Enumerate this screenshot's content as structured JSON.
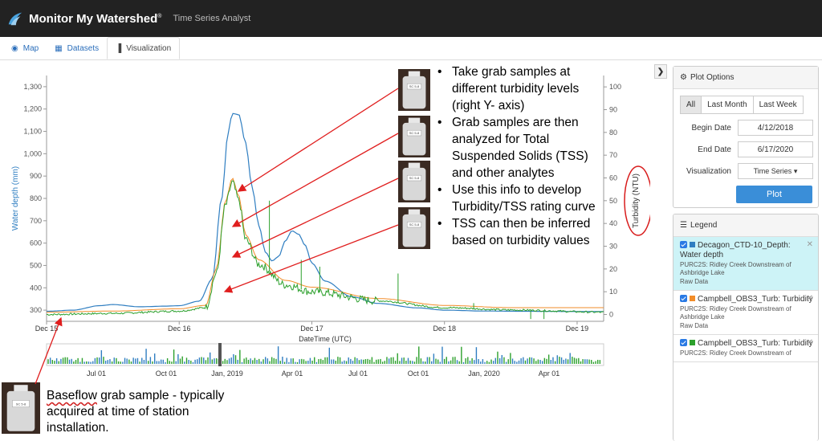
{
  "app": {
    "brand": "Monitor My Watershed",
    "trademark": "®",
    "subtitle": "Time Series Analyst"
  },
  "tabs": [
    {
      "label": "Map",
      "icon": "map-marker-icon"
    },
    {
      "label": "Datasets",
      "icon": "table-icon"
    },
    {
      "label": "Visualization",
      "icon": "bar-chart-icon"
    }
  ],
  "plot_options": {
    "title": "Plot Options",
    "range_buttons": [
      "All",
      "Last Month",
      "Last Week"
    ],
    "begin_label": "Begin Date",
    "begin_value": "4/12/2018",
    "end_label": "End Date",
    "end_value": "6/17/2020",
    "viz_label": "Visualization",
    "viz_value": "Time Series",
    "plot_button": "Plot"
  },
  "legend": {
    "title": "Legend",
    "items": [
      {
        "name": "Decagon_CTD-10_Depth: Water depth",
        "site": "PURC2S: Ridley Creek Downstream of Ashbridge Lake",
        "level": "Raw Data",
        "color": "#2f7ec1"
      },
      {
        "name": "Campbell_OBS3_Turb: Turbidity",
        "site": "PURC2S: Ridley Creek Downstream of Ashbridge Lake",
        "level": "Raw Data",
        "color": "#f28c28"
      },
      {
        "name": "Campbell_OBS3_Turb: Turbidity",
        "site": "PURC2S: Ridley Creek Downstream of",
        "level": "",
        "color": "#2ca02c"
      }
    ]
  },
  "annotations": {
    "bullets": [
      "Take grab samples at different turbidity levels (right Y- axis)",
      "Grab samples are then analyzed for Total Suspended Solids (TSS) and other analytes",
      "Use this info to develop Turbidity/TSS rating curve",
      "TSS can then be inferred based on turbidity values"
    ],
    "baseflow_underlined": "Baseflow",
    "baseflow_rest": " grab sample - typically acquired at time of station installation.",
    "sample_label": "SC 5-8"
  },
  "chart_data": {
    "type": "line",
    "xlabel": "DateTime (UTC)",
    "ylabel": "Water depth (mm)",
    "y2label": "Turbidity (NTU)",
    "ylim": [
      250,
      1350
    ],
    "y2lim": [
      -3,
      105
    ],
    "yticks": [
      "300",
      "400",
      "500",
      "600",
      "700",
      "800",
      "900",
      "1,000",
      "1,100",
      "1,200",
      "1,300"
    ],
    "y2ticks": [
      "0",
      "10",
      "20",
      "30",
      "40",
      "50",
      "60",
      "70",
      "80",
      "90",
      "100"
    ],
    "xticks": [
      "Dec 15",
      "Dec 16",
      "Dec 17",
      "Dec 18",
      "Dec 19"
    ],
    "xrange_days": [
      15,
      19.2
    ],
    "series": [
      {
        "name": "Decagon_CTD-10_Depth: Water depth",
        "axis": "left",
        "color": "#2f7ec1",
        "x": [
          15.0,
          15.2,
          15.4,
          15.5,
          15.7,
          15.9,
          16.0,
          16.15,
          16.25,
          16.32,
          16.37,
          16.4,
          16.45,
          16.5,
          16.55,
          16.6,
          16.65,
          16.7,
          16.75,
          16.8,
          16.85,
          16.9,
          16.95,
          17.0,
          17.1,
          17.3,
          17.5,
          17.8,
          18.0,
          18.3,
          18.6,
          18.9,
          19.2
        ],
        "y": [
          295,
          300,
          320,
          325,
          315,
          318,
          320,
          340,
          440,
          800,
          1100,
          1180,
          1175,
          1050,
          850,
          680,
          560,
          520,
          540,
          610,
          655,
          640,
          590,
          510,
          430,
          360,
          330,
          310,
          300,
          296,
          295,
          294,
          294
        ]
      },
      {
        "name": "Campbell_OBS3_Turb: Turbidity",
        "axis": "right",
        "color": "#f28c28",
        "x": [
          15.0,
          15.5,
          16.0,
          16.2,
          16.28,
          16.35,
          16.4,
          16.45,
          16.5,
          16.6,
          16.8,
          17.0,
          17.5,
          18.0,
          18.5,
          19.2
        ],
        "y": [
          1,
          1.5,
          2.5,
          4,
          20,
          50,
          60,
          52,
          35,
          24,
          15,
          12,
          7,
          4,
          3,
          3
        ]
      },
      {
        "name": "Campbell_OBS3_Turb: Turbidity",
        "axis": "right",
        "color": "#2ca02c",
        "x": [
          15.0,
          15.5,
          16.0,
          16.2,
          16.28,
          16.35,
          16.4,
          16.45,
          16.5,
          16.6,
          16.8,
          17.0,
          17.5,
          18.0,
          18.5,
          19.2
        ],
        "y": [
          0,
          0.5,
          1.5,
          3,
          18,
          48,
          58,
          50,
          33,
          22,
          13,
          10,
          6,
          3,
          2,
          1
        ]
      }
    ],
    "navigator_ticks": [
      "Jul 01",
      "Oct 01",
      "Jan, 2019",
      "Apr 01",
      "Jul 01",
      "Oct 01",
      "Jan, 2020",
      "Apr 01"
    ]
  }
}
